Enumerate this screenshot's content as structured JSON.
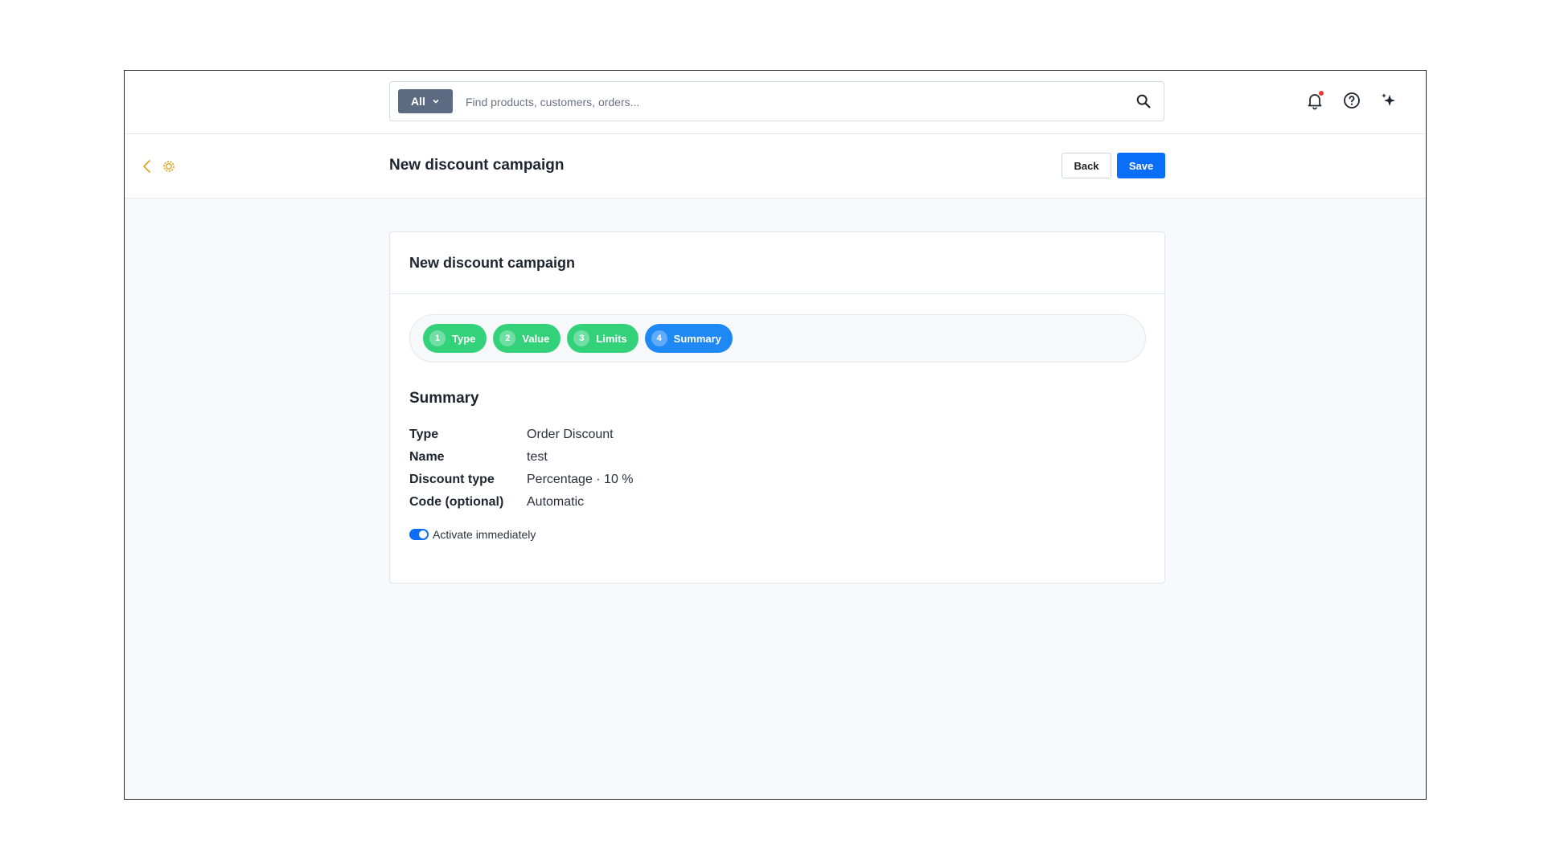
{
  "search": {
    "scope": "All",
    "placeholder": "Find products, customers, orders..."
  },
  "header": {
    "title": "New discount campaign",
    "back_label": "Back",
    "save_label": "Save"
  },
  "card": {
    "title": "New discount campaign",
    "steps": [
      {
        "num": "1",
        "label": "Type",
        "state": "done"
      },
      {
        "num": "2",
        "label": "Value",
        "state": "done"
      },
      {
        "num": "3",
        "label": "Limits",
        "state": "done"
      },
      {
        "num": "4",
        "label": "Summary",
        "state": "active"
      }
    ],
    "summary_heading": "Summary",
    "rows": [
      {
        "label": "Type",
        "value": "Order Discount"
      },
      {
        "label": "Name",
        "value": "test"
      },
      {
        "label": "Discount type",
        "value": "Percentage · 10 %"
      },
      {
        "label": "Code (optional)",
        "value": "Automatic"
      }
    ],
    "toggle_label": "Activate immediately",
    "toggle_on": true
  },
  "icons": {
    "search": "search-icon",
    "scope_dropdown": "chevron-down-icon",
    "notifications": "bell-icon",
    "help": "help-circle-icon",
    "ai": "sparkle-icon",
    "back": "chevron-left-icon",
    "settings": "gear-icon"
  },
  "colors": {
    "primary": "#0b6ef8",
    "step_done": "#34d17b",
    "step_active": "#1e88f5",
    "accent_icons": "#e0a526",
    "notification_dot": "#e53935"
  }
}
